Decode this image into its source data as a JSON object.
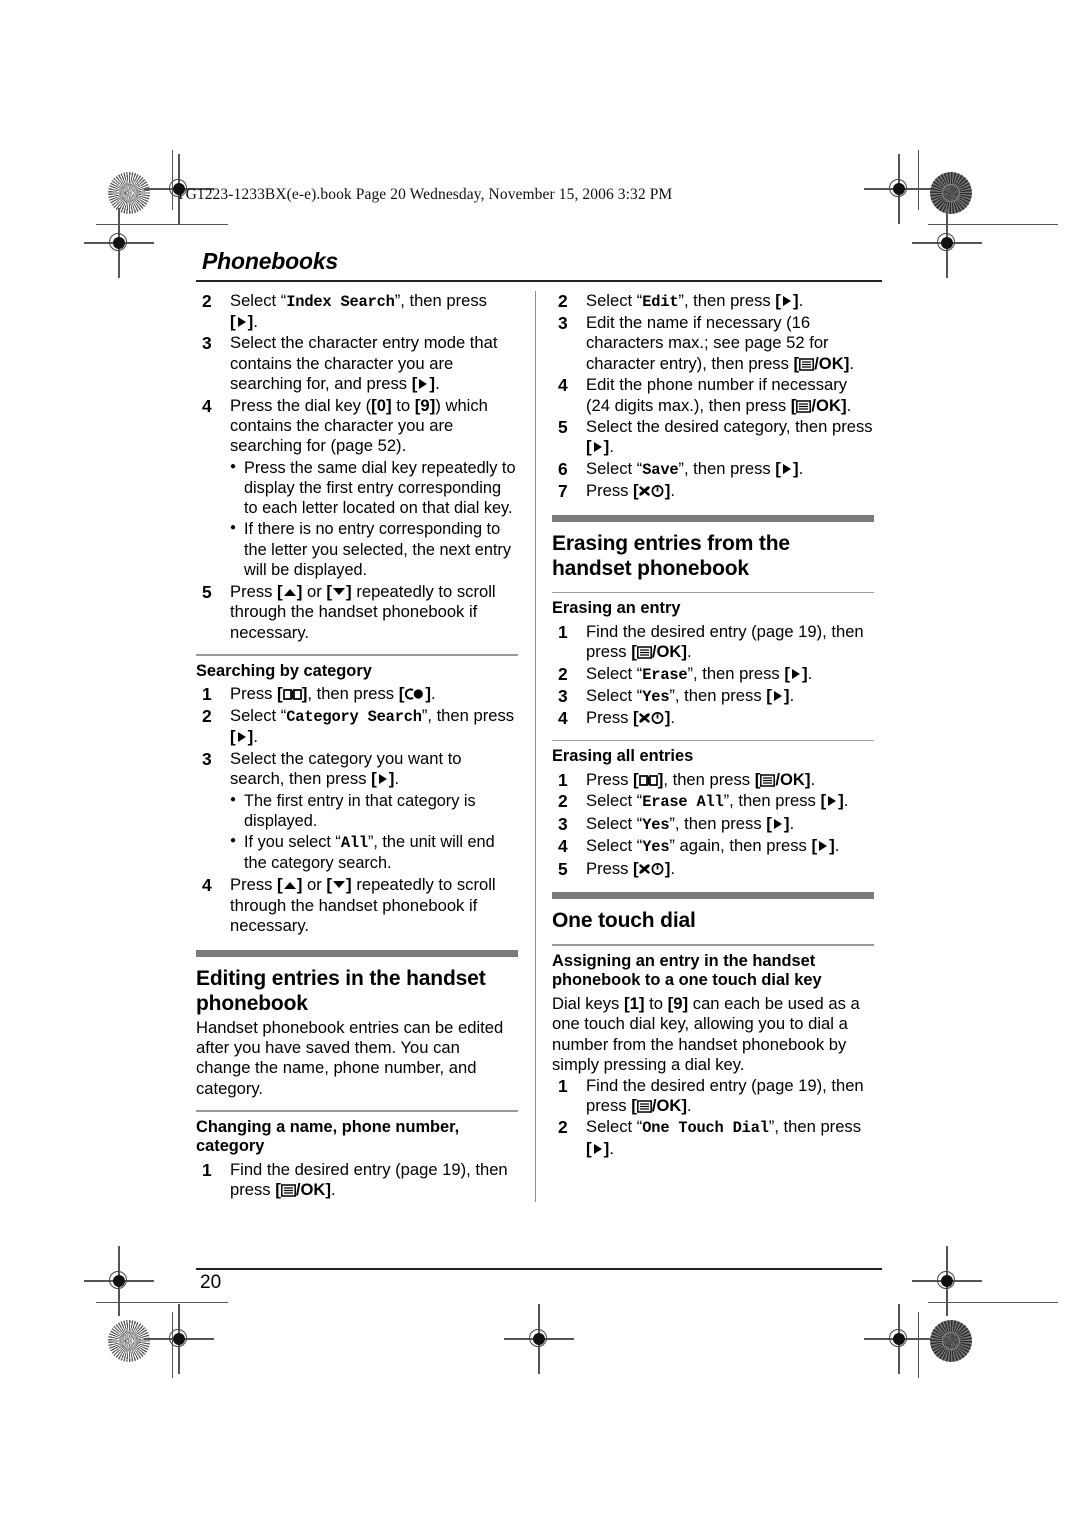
{
  "document": {
    "header_line": "TG1223-1233BX(e-e).book  Page 20  Wednesday, November 15, 2006  3:32 PM",
    "running_head": "Phonebooks",
    "page_number": "20"
  },
  "icons": {
    "right_soft_key": "right-arrow-key-icon",
    "up_key": "up-arrow-key-icon",
    "down_key": "down-arrow-key-icon",
    "phonebook_key": "phonebook-book-icon",
    "talk_key": "talk-key-icon",
    "menu_ok_key": "menu-ok-key-icon",
    "off_power_key": "off-power-key-icon"
  },
  "left_column": {
    "index_search_steps": [
      {
        "num": "2",
        "parts": [
          {
            "t": "text",
            "v": "Select "
          },
          {
            "t": "quote_mono",
            "v": "Index Search"
          },
          {
            "t": "text",
            "v": ", then press "
          },
          {
            "t": "key",
            "v": "right"
          },
          {
            "t": "text",
            "v": "."
          }
        ]
      },
      {
        "num": "3",
        "parts": [
          {
            "t": "text",
            "v": "Select the character entry mode that contains the character you are searching for, and press "
          },
          {
            "t": "key",
            "v": "right"
          },
          {
            "t": "text",
            "v": "."
          }
        ]
      },
      {
        "num": "4",
        "parts": [
          {
            "t": "text",
            "v": "Press the dial key ("
          },
          {
            "t": "keylabel",
            "v": "0"
          },
          {
            "t": "text",
            "v": " to "
          },
          {
            "t": "keylabel",
            "v": "9"
          },
          {
            "t": "text",
            "v": ") which contains the character you are searching for (page 52)."
          }
        ],
        "bullets": [
          "Press the same dial key repeatedly to display the first entry corresponding to each letter located on that dial key.",
          "If there is no entry corresponding to the letter you selected, the next entry will be displayed."
        ]
      },
      {
        "num": "5",
        "parts": [
          {
            "t": "text",
            "v": "Press "
          },
          {
            "t": "key",
            "v": "up"
          },
          {
            "t": "text",
            "v": " or "
          },
          {
            "t": "key",
            "v": "down"
          },
          {
            "t": "text",
            "v": " repeatedly to scroll through the handset phonebook if necessary."
          }
        ]
      }
    ],
    "searching_by_category": {
      "heading": "Searching by category",
      "steps": [
        {
          "num": "1",
          "parts": [
            {
              "t": "text",
              "v": "Press "
            },
            {
              "t": "key",
              "v": "book"
            },
            {
              "t": "text",
              "v": ", then press "
            },
            {
              "t": "key",
              "v": "talk"
            },
            {
              "t": "text",
              "v": "."
            }
          ]
        },
        {
          "num": "2",
          "parts": [
            {
              "t": "text",
              "v": "Select "
            },
            {
              "t": "quote_mono",
              "v": "Category Search"
            },
            {
              "t": "text",
              "v": ", then press "
            },
            {
              "t": "key",
              "v": "right"
            },
            {
              "t": "text",
              "v": "."
            }
          ]
        },
        {
          "num": "3",
          "parts": [
            {
              "t": "text",
              "v": "Select the category you want to search, then press "
            },
            {
              "t": "key",
              "v": "right"
            },
            {
              "t": "text",
              "v": "."
            }
          ],
          "bullets_rich": [
            [
              {
                "t": "text",
                "v": "The first entry in that category is displayed."
              }
            ],
            [
              {
                "t": "text",
                "v": "If you select "
              },
              {
                "t": "quote_mono",
                "v": "All"
              },
              {
                "t": "text",
                "v": ", the unit will end the category search."
              }
            ]
          ]
        },
        {
          "num": "4",
          "parts": [
            {
              "t": "text",
              "v": "Press "
            },
            {
              "t": "key",
              "v": "up"
            },
            {
              "t": "text",
              "v": " or "
            },
            {
              "t": "key",
              "v": "down"
            },
            {
              "t": "text",
              "v": " repeatedly to scroll through the handset phonebook if necessary."
            }
          ]
        }
      ]
    },
    "editing_section": {
      "heading": "Editing entries in the handset phonebook",
      "paragraph": "Handset phonebook entries can be edited after you have saved them. You can change the name, phone number, and category.",
      "subheading": "Changing a name, phone number, category",
      "steps": [
        {
          "num": "1",
          "parts": [
            {
              "t": "text",
              "v": "Find the desired entry (page 19), then press "
            },
            {
              "t": "key",
              "v": "menuok"
            },
            {
              "t": "text",
              "v": "."
            }
          ]
        }
      ]
    }
  },
  "right_column": {
    "editing_steps_cont": [
      {
        "num": "2",
        "parts": [
          {
            "t": "text",
            "v": "Select "
          },
          {
            "t": "quote_mono",
            "v": "Edit"
          },
          {
            "t": "text",
            "v": ", then press "
          },
          {
            "t": "key",
            "v": "right"
          },
          {
            "t": "text",
            "v": "."
          }
        ]
      },
      {
        "num": "3",
        "parts": [
          {
            "t": "text",
            "v": "Edit the name if necessary (16 characters max.; see page 52 for character entry), then press "
          },
          {
            "t": "key",
            "v": "menuok"
          },
          {
            "t": "text",
            "v": "."
          }
        ]
      },
      {
        "num": "4",
        "parts": [
          {
            "t": "text",
            "v": "Edit the phone number if necessary (24 digits max.), then press "
          },
          {
            "t": "key",
            "v": "menuok"
          },
          {
            "t": "text",
            "v": "."
          }
        ]
      },
      {
        "num": "5",
        "parts": [
          {
            "t": "text",
            "v": "Select the desired category, then press "
          },
          {
            "t": "key",
            "v": "right"
          },
          {
            "t": "text",
            "v": "."
          }
        ]
      },
      {
        "num": "6",
        "parts": [
          {
            "t": "text",
            "v": "Select "
          },
          {
            "t": "quote_mono",
            "v": "Save"
          },
          {
            "t": "text",
            "v": ", then press "
          },
          {
            "t": "key",
            "v": "right"
          },
          {
            "t": "text",
            "v": "."
          }
        ]
      },
      {
        "num": "7",
        "parts": [
          {
            "t": "text",
            "v": "Press "
          },
          {
            "t": "key",
            "v": "off"
          },
          {
            "t": "text",
            "v": "."
          }
        ]
      }
    ],
    "erasing_section": {
      "heading": "Erasing entries from the handset phonebook",
      "erasing_an_entry": {
        "subheading": "Erasing an entry",
        "steps": [
          {
            "num": "1",
            "parts": [
              {
                "t": "text",
                "v": "Find the desired entry (page 19), then press "
              },
              {
                "t": "key",
                "v": "menuok"
              },
              {
                "t": "text",
                "v": "."
              }
            ]
          },
          {
            "num": "2",
            "parts": [
              {
                "t": "text",
                "v": "Select "
              },
              {
                "t": "quote_mono",
                "v": "Erase"
              },
              {
                "t": "text",
                "v": ", then press "
              },
              {
                "t": "key",
                "v": "right"
              },
              {
                "t": "text",
                "v": "."
              }
            ]
          },
          {
            "num": "3",
            "parts": [
              {
                "t": "text",
                "v": "Select "
              },
              {
                "t": "quote_mono",
                "v": "Yes"
              },
              {
                "t": "text",
                "v": ", then press "
              },
              {
                "t": "key",
                "v": "right"
              },
              {
                "t": "text",
                "v": "."
              }
            ]
          },
          {
            "num": "4",
            "parts": [
              {
                "t": "text",
                "v": "Press "
              },
              {
                "t": "key",
                "v": "off"
              },
              {
                "t": "text",
                "v": "."
              }
            ]
          }
        ]
      },
      "erasing_all_entries": {
        "subheading": "Erasing all entries",
        "steps": [
          {
            "num": "1",
            "parts": [
              {
                "t": "text",
                "v": "Press "
              },
              {
                "t": "key",
                "v": "book"
              },
              {
                "t": "text",
                "v": ", then press "
              },
              {
                "t": "key",
                "v": "menuok"
              },
              {
                "t": "text",
                "v": "."
              }
            ]
          },
          {
            "num": "2",
            "parts": [
              {
                "t": "text",
                "v": "Select "
              },
              {
                "t": "quote_mono",
                "v": "Erase All"
              },
              {
                "t": "text",
                "v": ", then press "
              },
              {
                "t": "key",
                "v": "right"
              },
              {
                "t": "text",
                "v": "."
              }
            ]
          },
          {
            "num": "3",
            "parts": [
              {
                "t": "text",
                "v": "Select "
              },
              {
                "t": "quote_mono",
                "v": "Yes"
              },
              {
                "t": "text",
                "v": ", then press "
              },
              {
                "t": "key",
                "v": "right"
              },
              {
                "t": "text",
                "v": "."
              }
            ]
          },
          {
            "num": "4",
            "parts": [
              {
                "t": "text",
                "v": "Select "
              },
              {
                "t": "quote_mono",
                "v": "Yes"
              },
              {
                "t": "text",
                "v": " again, then press "
              },
              {
                "t": "key",
                "v": "right"
              },
              {
                "t": "text",
                "v": "."
              }
            ]
          },
          {
            "num": "5",
            "parts": [
              {
                "t": "text",
                "v": "Press "
              },
              {
                "t": "key",
                "v": "off"
              },
              {
                "t": "text",
                "v": "."
              }
            ]
          }
        ]
      }
    },
    "one_touch_section": {
      "heading": "One touch dial",
      "subheading": "Assigning an entry in the handset phonebook to a one touch dial key",
      "paragraph_parts": [
        {
          "t": "text",
          "v": "Dial keys "
        },
        {
          "t": "keylabel",
          "v": "1"
        },
        {
          "t": "text",
          "v": " to "
        },
        {
          "t": "keylabel",
          "v": "9"
        },
        {
          "t": "text",
          "v": " can each be used as a one touch dial key, allowing you to dial a number from the handset phonebook by simply pressing a dial key."
        }
      ],
      "steps": [
        {
          "num": "1",
          "parts": [
            {
              "t": "text",
              "v": "Find the desired entry (page 19), then press "
            },
            {
              "t": "key",
              "v": "menuok"
            },
            {
              "t": "text",
              "v": "."
            }
          ]
        },
        {
          "num": "2",
          "parts": [
            {
              "t": "text",
              "v": "Select "
            },
            {
              "t": "quote_mono",
              "v": "One Touch Dial"
            },
            {
              "t": "text",
              "v": ", then press "
            },
            {
              "t": "key",
              "v": "right"
            },
            {
              "t": "text",
              "v": "."
            }
          ]
        }
      ]
    }
  }
}
